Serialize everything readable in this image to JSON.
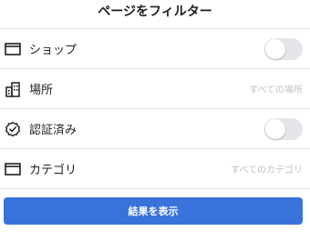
{
  "header": {
    "title": "ページをフィルター"
  },
  "filters": [
    {
      "icon": "storefront-icon",
      "label": "ショップ",
      "control": "toggle",
      "on": false
    },
    {
      "icon": "city-icon",
      "label": "場所",
      "control": "value",
      "value": "すべての場所"
    },
    {
      "icon": "verified-badge-icon",
      "label": "認証済み",
      "control": "toggle",
      "on": false
    },
    {
      "icon": "storefront-icon",
      "label": "カテゴリ",
      "control": "value",
      "value": "すべてのカテゴリ"
    }
  ],
  "actions": {
    "show_results_label": "結果を表示"
  },
  "colors": {
    "accent": "#3a72dc",
    "divider": "#e4e6eb",
    "muted_text": "#bcc0c4",
    "toggle_off": "#e4e6eb"
  }
}
